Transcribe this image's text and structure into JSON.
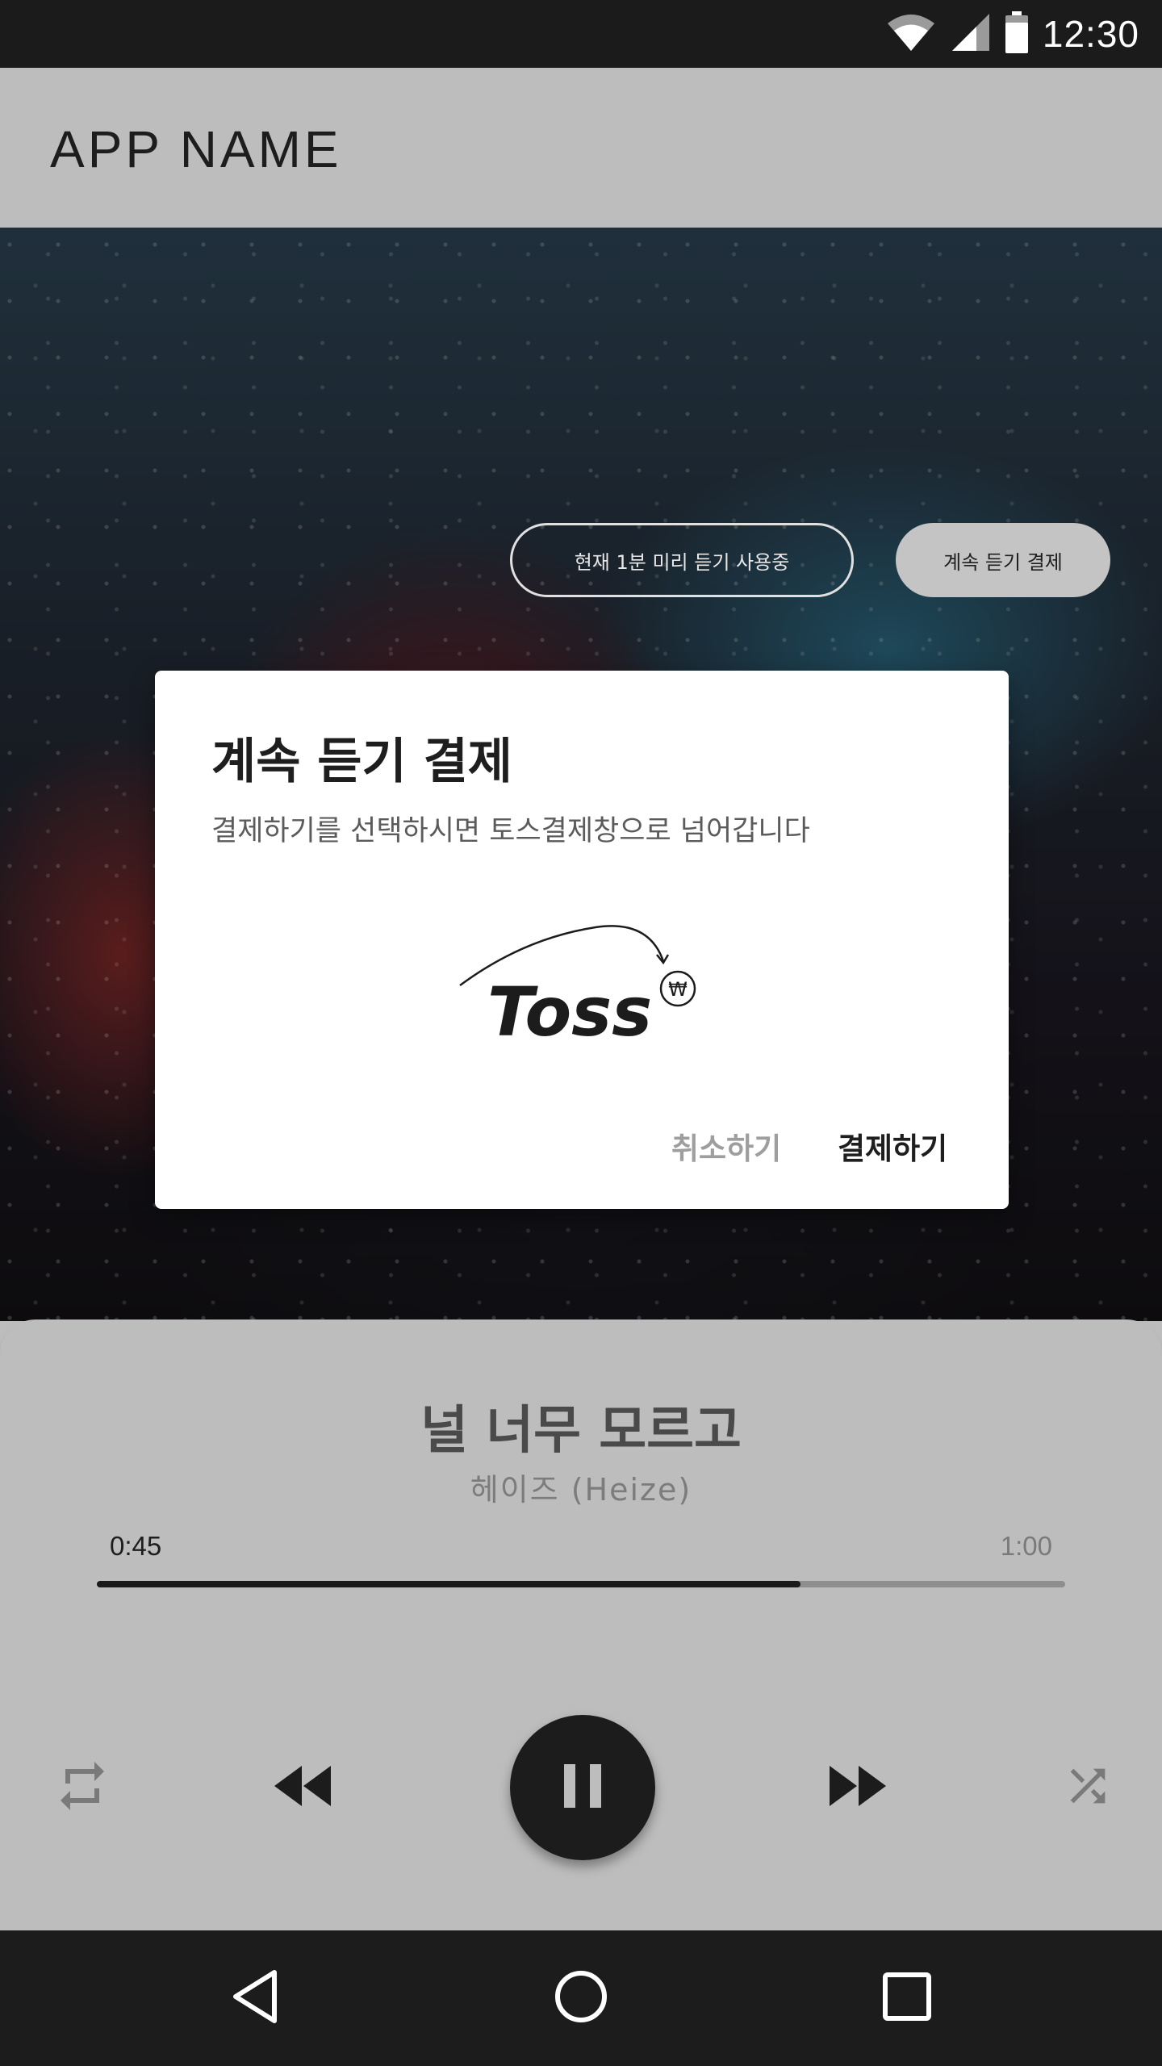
{
  "status_bar": {
    "time": "12:30",
    "icons": [
      "wifi-icon",
      "signal-icon",
      "battery-icon"
    ]
  },
  "app_bar": {
    "title": "APP NAME"
  },
  "hero": {
    "preview_label": "현재 1분 미리 듣기 사용중",
    "pay_button_label": "계속 듣기 결제"
  },
  "dialog": {
    "title": "계속 듣기 결제",
    "message": "결제하기를 선택하시면 토스결제창으로 넘어갑니다",
    "logo_text": "Toss",
    "logo_symbol": "₩",
    "cancel_label": "취소하기",
    "confirm_label": "결제하기"
  },
  "player": {
    "song_title": "널 너무 모르고",
    "artist": "헤이즈 (Heize)",
    "current_time": "0:45",
    "total_time": "1:00",
    "progress_percent": 72.7
  },
  "controls": {
    "icons": [
      "repeat-icon",
      "rewind-icon",
      "pause-icon",
      "fast-forward-icon",
      "shuffle-icon"
    ]
  },
  "nav_bar": {
    "icons": [
      "back-icon",
      "home-icon",
      "recents-icon"
    ]
  },
  "colors": {
    "background": "#bdbdbd",
    "dark": "#1c1c1c",
    "dialog": "#ffffff",
    "muted_text": "#9e9e9e"
  }
}
